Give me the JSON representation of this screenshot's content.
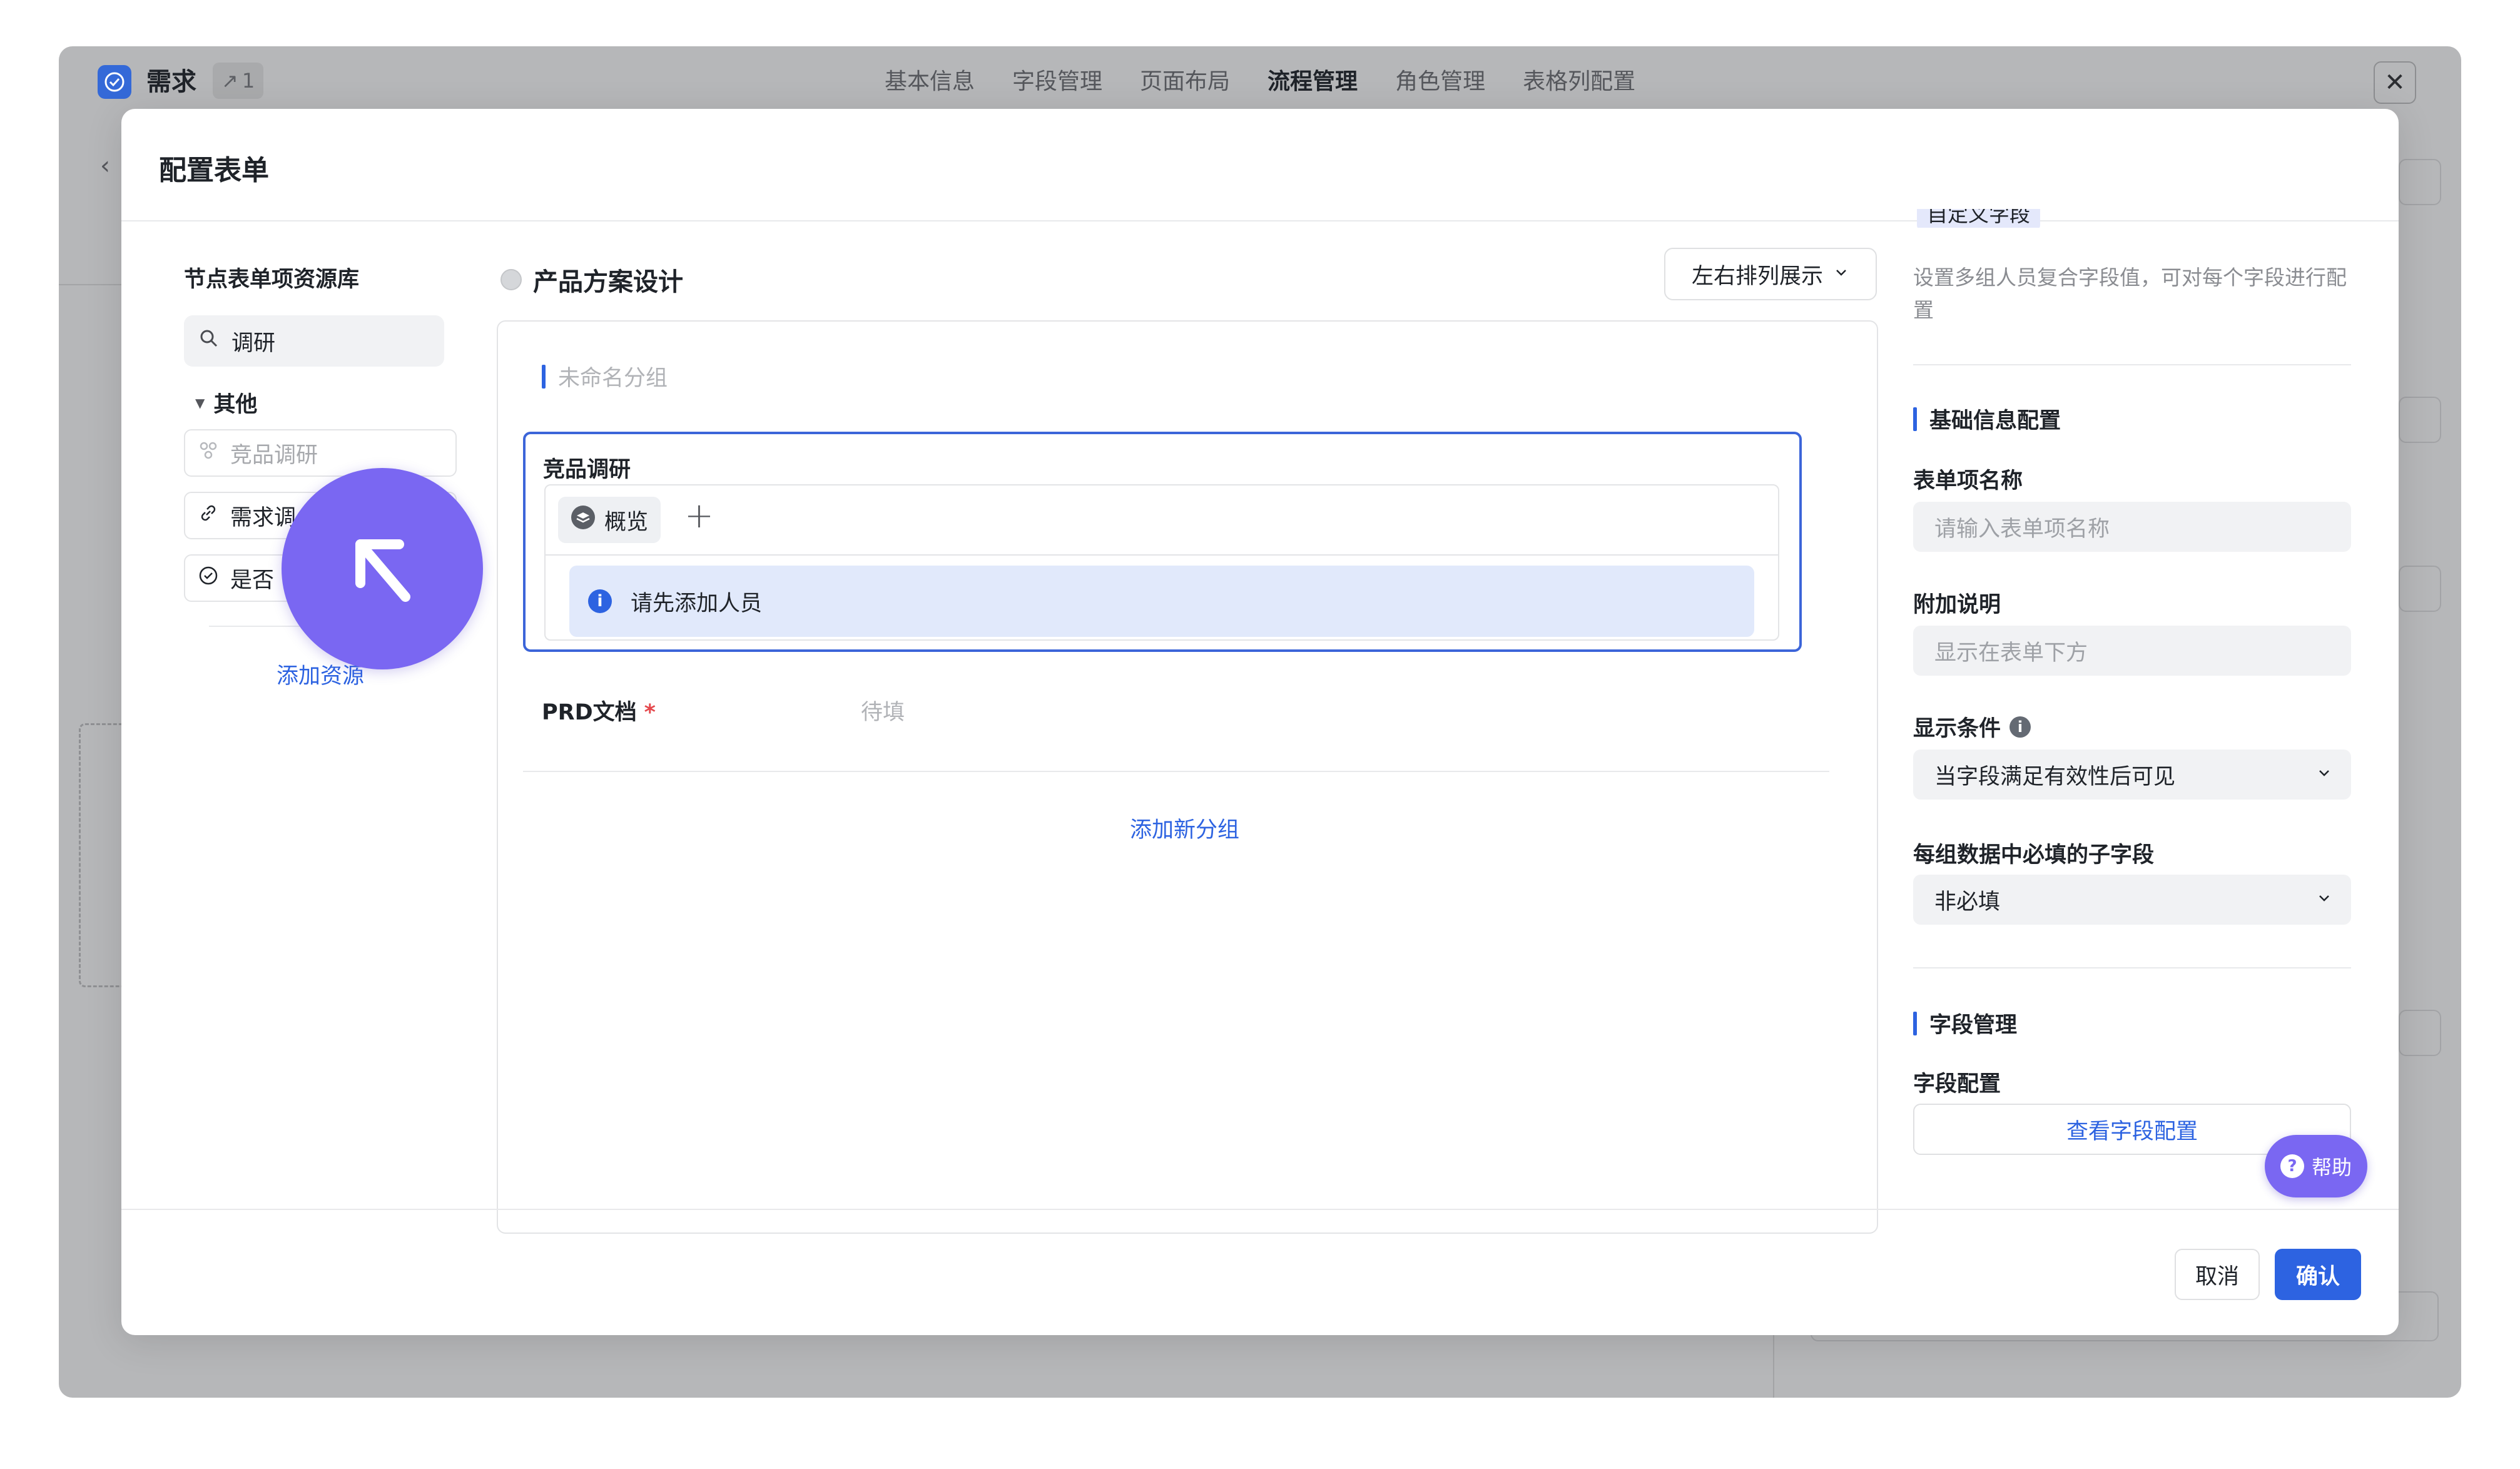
{
  "app": {
    "title": "需求",
    "badge": "1",
    "tabs": [
      "基本信息",
      "字段管理",
      "页面布局",
      "流程管理",
      "角色管理",
      "表格列配置"
    ],
    "active_tab": "流程管理"
  },
  "modal": {
    "title": "配置表单",
    "cancel_label": "取消",
    "confirm_label": "确认"
  },
  "library": {
    "title": "节点表单项资源库",
    "search_value": "调研",
    "group_label": "其他",
    "items": [
      {
        "label": "竞品调研",
        "icon": "people-icon"
      },
      {
        "label": "需求调",
        "icon": "link-icon"
      },
      {
        "label": "是否",
        "icon": "check-circle-icon"
      }
    ],
    "add_resource_label": "添加资源"
  },
  "form": {
    "title": "产品方案设计",
    "layout_select": "左右排列展示",
    "group_name": "未命名分组",
    "field_label": "竞品调研",
    "tab_label": "概览",
    "notice": "请先添加人员",
    "prd_label": "PRD文档",
    "required_mark": "*",
    "prd_placeholder": "待填",
    "add_group_label": "添加新分组"
  },
  "right_panel": {
    "clipped_tag": "自定义字段",
    "description": "设置多组人员复合字段值，可对每个字段进行配置",
    "section_basic": "基础信息配置",
    "name_label": "表单项名称",
    "name_placeholder": "请输入表单项名称",
    "extra_label": "附加说明",
    "extra_placeholder": "显示在表单下方",
    "condition_label": "显示条件",
    "condition_value": "当字段满足有效性后可见",
    "required_label": "每组数据中必填的子字段",
    "required_value": "非必填",
    "section_fields": "字段管理",
    "field_config_label": "字段配置",
    "view_fields_label": "查看字段配置"
  },
  "help": {
    "label": "帮助"
  },
  "colors": {
    "accent": "#2d63e1",
    "cursor": "#7a67f2"
  }
}
